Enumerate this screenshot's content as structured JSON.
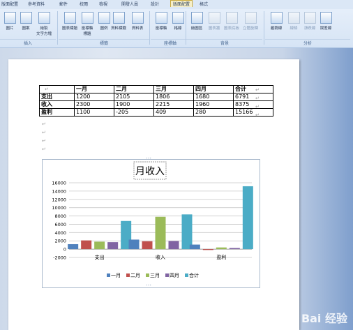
{
  "ribbon": {
    "tabs": [
      "版面配置",
      "參考資料",
      "郵件",
      "校閱",
      "檢視",
      "開發人員",
      "設計",
      "版面配置",
      "格式"
    ],
    "active_tab_index": 7,
    "buttons": [
      {
        "label": "圖片",
        "disabled": false
      },
      {
        "label": "圖案",
        "disabled": false
      },
      {
        "label": "繪製\n文字方塊",
        "disabled": false
      },
      {
        "label": "圖表標題",
        "disabled": false
      },
      {
        "label": "座標軸\n標題",
        "disabled": false
      },
      {
        "label": "圖例",
        "disabled": false
      },
      {
        "label": "資料標籤",
        "disabled": false
      },
      {
        "label": "資料表",
        "disabled": false
      },
      {
        "label": "座標軸",
        "disabled": false
      },
      {
        "label": "格線",
        "disabled": false
      },
      {
        "label": "繪圖區",
        "disabled": false
      },
      {
        "label": "圖表牆",
        "disabled": true
      },
      {
        "label": "圖表底板",
        "disabled": true
      },
      {
        "label": "立體旋轉",
        "disabled": true
      },
      {
        "label": "趨勢線",
        "disabled": false
      },
      {
        "label": "線條",
        "disabled": true
      },
      {
        "label": "漲跌線",
        "disabled": true
      },
      {
        "label": "誤差線",
        "disabled": false
      }
    ],
    "groups": [
      "插入",
      "標籤",
      "座標軸",
      "背景",
      "分析"
    ]
  },
  "table": {
    "header": [
      "",
      "一月",
      "二月",
      "三月",
      "四月",
      "合计"
    ],
    "rows": [
      [
        "支出",
        "1200",
        "2105",
        "1806",
        "1680",
        "6791"
      ],
      [
        "收入",
        "2300",
        "1900",
        "2215",
        "1960",
        "8375"
      ],
      [
        "盈利",
        "1100",
        "-205",
        "409",
        "280",
        "15166"
      ]
    ]
  },
  "chart_data": {
    "type": "bar",
    "title": "月收入",
    "categories": [
      "支出",
      "收入",
      "盈利"
    ],
    "series": [
      {
        "name": "一月",
        "values": [
          1200,
          2300,
          1100
        ],
        "color": "#4f81bd"
      },
      {
        "name": "二月",
        "values": [
          2105,
          1900,
          -205
        ],
        "color": "#c0504d"
      },
      {
        "name": "三月",
        "values": [
          1806,
          7800,
          409
        ],
        "color": "#9bbb59"
      },
      {
        "name": "四月",
        "values": [
          1680,
          1960,
          280
        ],
        "color": "#8064a2"
      },
      {
        "name": "合计",
        "values": [
          6791,
          8375,
          15166
        ],
        "color": "#4bacc6"
      }
    ],
    "ylim": [
      -2000,
      16000
    ],
    "yticks": [
      -2000,
      0,
      2000,
      4000,
      6000,
      8000,
      10000,
      12000,
      14000,
      16000
    ],
    "grid": true,
    "legend": "bottom"
  },
  "watermark": "Bai 经验"
}
